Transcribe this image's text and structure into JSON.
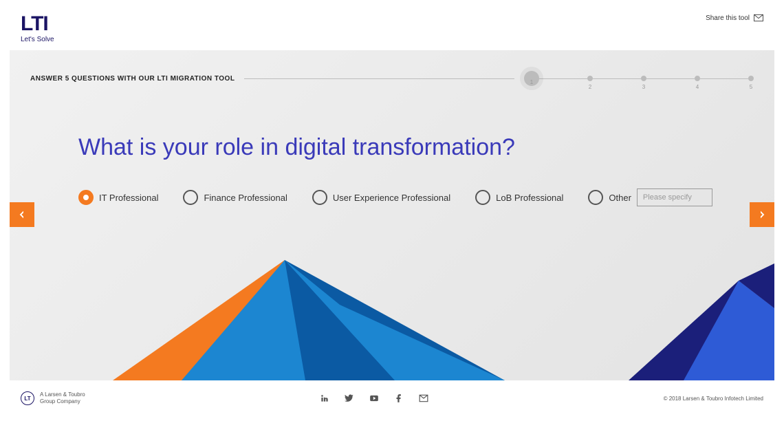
{
  "brand": {
    "name": "LTI",
    "tagline": "Let's Solve"
  },
  "share_label": "Share this tool",
  "panel": {
    "heading": "ANSWER 5 QUESTIONS WITH OUR LTI MIGRATION TOOL",
    "steps": [
      "1",
      "2",
      "3",
      "4",
      "5"
    ],
    "active_step": 1,
    "question": "What is your role in digital transformation?",
    "options": [
      {
        "label": "IT Professional",
        "selected": true
      },
      {
        "label": "Finance Professional",
        "selected": false
      },
      {
        "label": "User Experience Professional",
        "selected": false
      },
      {
        "label": "LoB Professional",
        "selected": false
      },
      {
        "label": "Other",
        "selected": false,
        "has_input": true
      }
    ],
    "other_placeholder": "Please specify"
  },
  "footer": {
    "company_line1": "A Larsen & Toubro",
    "company_line2": "Group Company",
    "copyright": "© 2018 Larsen & Toubro Infotech Limited"
  }
}
